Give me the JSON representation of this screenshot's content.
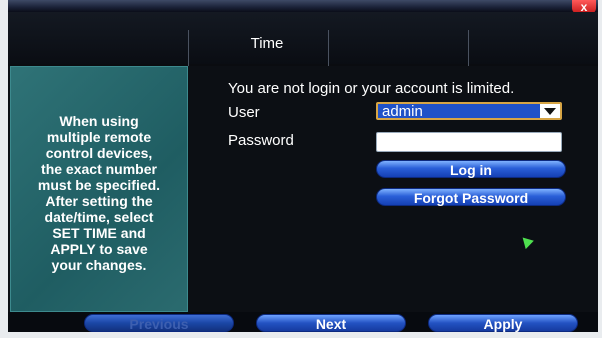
{
  "window": {
    "close_label": "x"
  },
  "tabs": {
    "active_label": "Time"
  },
  "help": {
    "text": "When using\nmultiple remote\ncontrol devices,\nthe exact number\nmust be specified.\nAfter setting the\ndate/time, select\nSET TIME and\nAPPLY to save\nyour changes."
  },
  "login": {
    "message": "You are not login or your account is limited.",
    "user_label": "User",
    "user_value": "admin",
    "password_label": "Password",
    "password_value": "",
    "login_button": "Log in",
    "forgot_button": "Forgot Password"
  },
  "footer": {
    "previous": "Previous",
    "next": "Next",
    "apply": "Apply"
  }
}
